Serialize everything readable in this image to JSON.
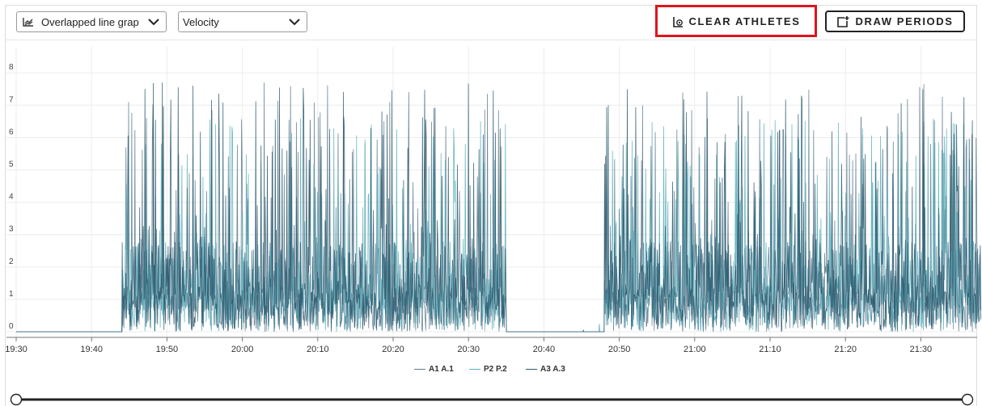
{
  "toolbar": {
    "graph_select": {
      "value": "Overlapped line grap",
      "icon": "line-graph-icon"
    },
    "metric_select": {
      "value": "Velocity"
    },
    "clear_button": {
      "label": "CLEAR ATHLETES",
      "icon": "clear-athletes-icon"
    },
    "draw_button": {
      "label": "DRAW PERIODS",
      "icon": "draw-periods-icon"
    },
    "highlight_color": "#e0141c"
  },
  "chart_data": {
    "type": "line",
    "title": "",
    "xlabel": "",
    "ylabel": "",
    "x_ticks": [
      "19:30",
      "19:40",
      "19:50",
      "20:00",
      "20:10",
      "20:20",
      "20:30",
      "20:40",
      "20:50",
      "21:00",
      "21:10",
      "21:20",
      "21:30"
    ],
    "y_ticks": [
      "0",
      "1",
      "2",
      "3",
      "4",
      "5",
      "6",
      "7",
      "8"
    ],
    "xlim": [
      "19:30",
      "21:38"
    ],
    "ylim": [
      0,
      8.8
    ],
    "grid": true,
    "legend_position": "bottom-center",
    "activity_periods": [
      {
        "start": "19:44",
        "end": "20:35"
      },
      {
        "start": "20:48",
        "end": "21:38"
      }
    ],
    "series": [
      {
        "name": "A1 A.1",
        "color": "#5d7b8e",
        "peak": 7.7
      },
      {
        "name": "P2 P.2",
        "color": "#5fb0bd",
        "peak": 6.6
      },
      {
        "name": "A3 A.3",
        "color": "#2e5b70",
        "peak": 7.7
      }
    ]
  }
}
